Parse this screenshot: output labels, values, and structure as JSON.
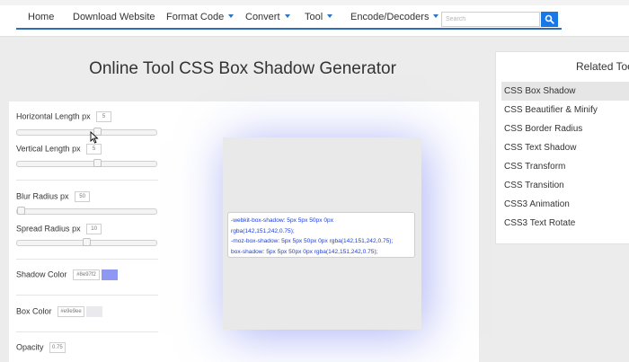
{
  "nav": {
    "items": [
      {
        "label": "Home",
        "has_caret": false
      },
      {
        "label": "Download Website",
        "has_caret": false
      },
      {
        "label": "Format Code",
        "has_caret": true
      },
      {
        "label": "Convert",
        "has_caret": true
      },
      {
        "label": "Tool",
        "has_caret": true
      },
      {
        "label": "Encode/Decoders",
        "has_caret": true
      }
    ],
    "search_placeholder": "Search",
    "accent_color": "#1a78e6"
  },
  "page": {
    "title": "Online Tool CSS Box Shadow Generator"
  },
  "controls": {
    "unit": "px",
    "horizontal": {
      "label": "Horizontal Length",
      "value": "5"
    },
    "vertical": {
      "label": "Vertical Length",
      "value": "5"
    },
    "blur": {
      "label": "Blur Radius",
      "value": "50"
    },
    "spread": {
      "label": "Spread Radius",
      "value": "10"
    },
    "shadow_color": {
      "label": "Shadow Color",
      "value": "#8e97f2",
      "swatch": "#8e97f2"
    },
    "box_color": {
      "label": "Box Color",
      "value": "#e9e9ee",
      "swatch": "#e9e9ee"
    },
    "opacity": {
      "label": "Opacity",
      "value": "0.75"
    }
  },
  "output": {
    "lines": [
      "-webkit-box-shadow: 5px 5px 50px 0px",
      "rgba(142,151,242,0.75);",
      "-moz-box-shadow: 5px 5px 50px 0px rgba(142,151,242,0.75);",
      "box-shadow: 5px 5px 50px 0px rgba(142,151,242,0.75);"
    ]
  },
  "related": {
    "title": "Related Tools",
    "items": [
      "CSS Box Shadow",
      "CSS Beautifier & Minify",
      "CSS Border Radius",
      "CSS Text Shadow",
      "CSS Transform",
      "CSS Transition",
      "CSS3 Animation",
      "CSS3 Text Rotate"
    ],
    "active_index": 0
  }
}
